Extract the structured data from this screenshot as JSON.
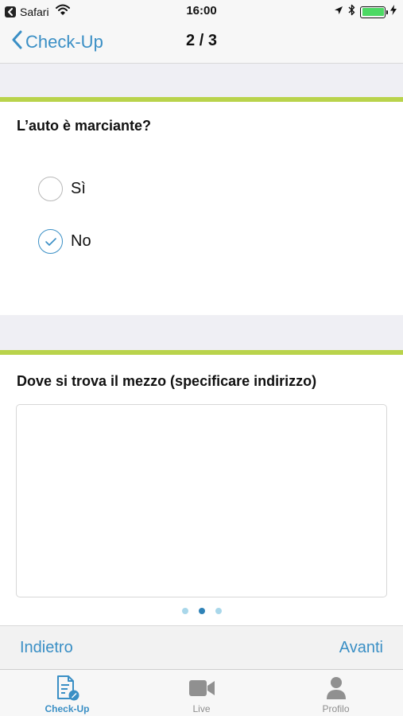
{
  "status_bar": {
    "app_name": "Safari",
    "time": "16:00",
    "battery_level": 1.0,
    "battery_color": "#4cd964"
  },
  "nav": {
    "back_label": "Check-Up",
    "title": "2 / 3",
    "accent_color": "#3a8fc5"
  },
  "question1": {
    "title": "L’auto è marciante?",
    "options": [
      {
        "label": "Sì",
        "selected": false
      },
      {
        "label": "No",
        "selected": true
      }
    ]
  },
  "question2": {
    "title": "Dove si trova il mezzo (specificare indirizzo)",
    "answer_value": ""
  },
  "pager": {
    "total": 3,
    "current": 2
  },
  "actions": {
    "back_label": "Indietro",
    "next_label": "Avanti"
  },
  "tabs": [
    {
      "label": "Check-Up",
      "icon": "checkup-document-icon",
      "active": true
    },
    {
      "label": "Live",
      "icon": "video-camera-icon",
      "active": false
    },
    {
      "label": "Profilo",
      "icon": "person-icon",
      "active": false
    }
  ],
  "colors": {
    "section_accent": "#b9d34b",
    "section_background": "#efeff4"
  }
}
